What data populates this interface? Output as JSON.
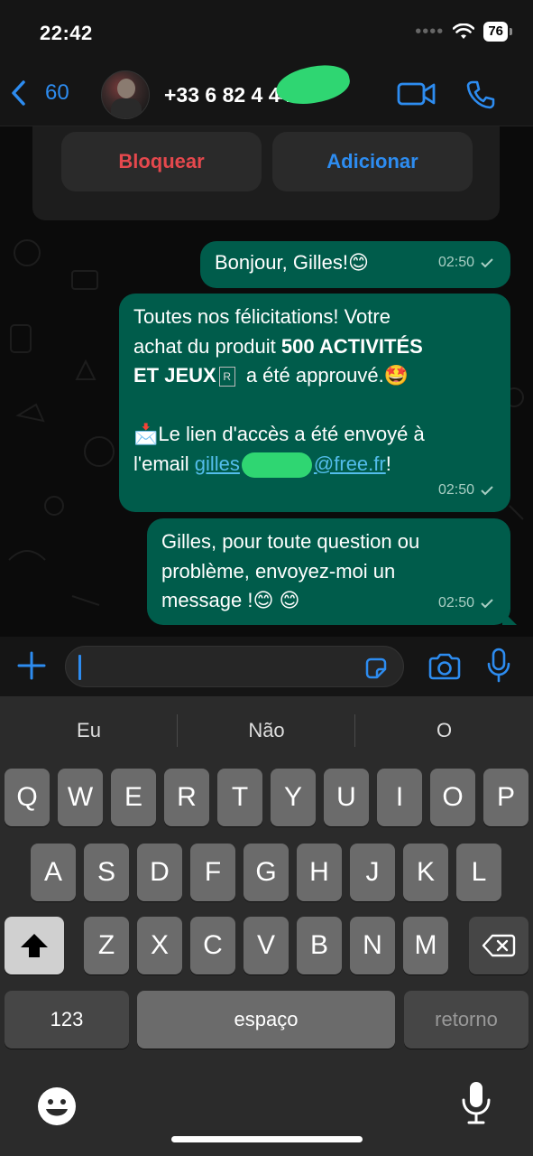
{
  "status_bar": {
    "time": "22:42",
    "battery": "76"
  },
  "header": {
    "back_count": "60",
    "contact": "+33 6 82 4      44"
  },
  "actions": {
    "block_label": "Bloquear",
    "add_label": "Adicionar"
  },
  "messages": [
    {
      "text": "Bonjour, Gilles!😊",
      "time": "02:50"
    },
    {
      "line1": "Toutes nos félicitations! Votre",
      "line2_plain": "achat du produit ",
      "line2_bold": "500 ACTIVITÉS",
      "line3_bold": "ET JEUX",
      "line3_symbol": "R",
      "line3_plain": "a été approuvé.🤩",
      "line4": "📩Le lien d'accès a été envoyé à",
      "line5_plain": "l'email ",
      "line5_link_start": "gilles",
      "line5_link_end": "@free.fr",
      "line5_tail": "!",
      "time": "02:50"
    },
    {
      "line1": "Gilles, pour toute question ou",
      "line2": "problème, envoyez-moi un",
      "line3": "message !😊 😊",
      "time": "02:50"
    }
  ],
  "keyboard": {
    "suggestions": [
      "Eu",
      "Não",
      "O"
    ],
    "row1": [
      "Q",
      "W",
      "E",
      "R",
      "T",
      "Y",
      "U",
      "I",
      "O",
      "P"
    ],
    "row2": [
      "A",
      "S",
      "D",
      "F",
      "G",
      "H",
      "J",
      "K",
      "L"
    ],
    "row3": [
      "Z",
      "X",
      "C",
      "V",
      "B",
      "N",
      "M"
    ],
    "numbers_label": "123",
    "space_label": "espaço",
    "return_label": "retorno"
  },
  "colors": {
    "accent": "#2d8cf0",
    "bubble": "#005c4b",
    "block": "#e5484d",
    "link": "#53bdeb"
  },
  "icons": [
    "back-chevron-icon",
    "video-call-icon",
    "phone-icon",
    "plus-icon",
    "sticker-icon",
    "camera-icon",
    "microphone-icon",
    "shift-icon",
    "backspace-icon",
    "emoji-icon",
    "dictation-icon"
  ]
}
